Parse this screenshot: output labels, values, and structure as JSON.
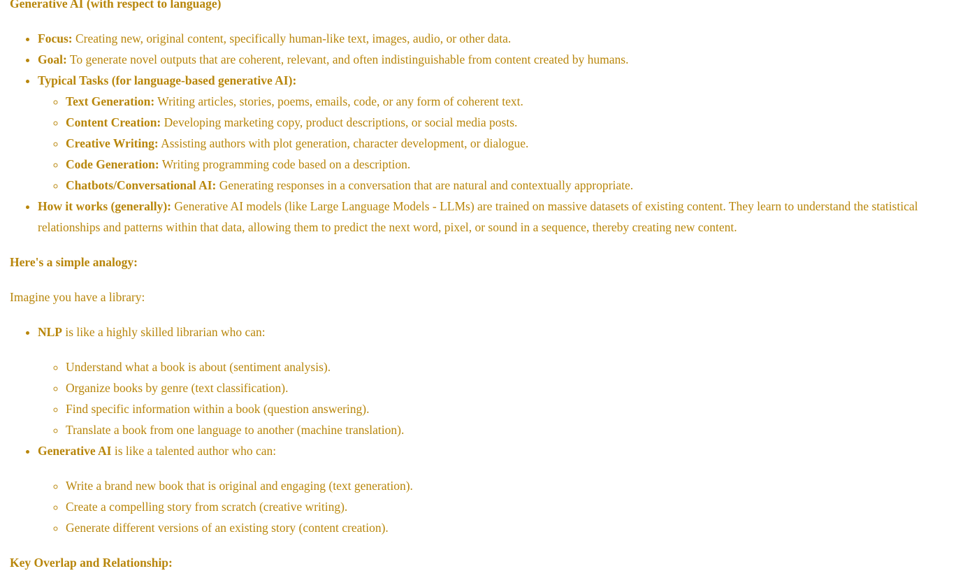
{
  "heading1": "Generative AI (with respect to language)",
  "genai_list": [
    {
      "label": "Focus:",
      "text": " Creating new, original content, specifically human-like text, images, audio, or other data."
    },
    {
      "label": "Goal:",
      "text": " To generate novel outputs that are coherent, relevant, and often indistinguishable from content created by humans."
    },
    {
      "label": "Typical Tasks (for language-based generative AI):",
      "text": ""
    },
    {
      "label": "How it works (generally):",
      "text": " Generative AI models (like Large Language Models - LLMs) are trained on massive datasets of existing content. They learn to understand the statistical relationships and patterns within that data, allowing them to predict the next word, pixel, or sound in a sequence, thereby creating new content."
    }
  ],
  "tasks": [
    {
      "label": "Text Generation:",
      "text": " Writing articles, stories, poems, emails, code, or any form of coherent text."
    },
    {
      "label": "Content Creation:",
      "text": " Developing marketing copy, product descriptions, or social media posts."
    },
    {
      "label": "Creative Writing:",
      "text": " Assisting authors with plot generation, character development, or dialogue."
    },
    {
      "label": "Code Generation:",
      "text": " Writing programming code based on a description."
    },
    {
      "label": "Chatbots/Conversational AI:",
      "text": " Generating responses in a conversation that are natural and contextually appropriate."
    }
  ],
  "heading2": "Here's a simple analogy:",
  "intro": "Imagine you have a library:",
  "analogy": [
    {
      "label": "NLP",
      "text": " is like a highly skilled librarian who can:",
      "items": [
        "Understand what a book is about (sentiment analysis).",
        "Organize books by genre (text classification).",
        "Find specific information within a book (question answering).",
        "Translate a book from one language to another (machine translation)."
      ]
    },
    {
      "label": "Generative AI",
      "text": " is like a talented author who can:",
      "items": [
        "Write a brand new book that is original and engaging (text generation).",
        "Create a compelling story from scratch (creative writing).",
        "Generate different versions of an existing story (content creation)."
      ]
    }
  ],
  "heading3": "Key Overlap and Relationship:"
}
